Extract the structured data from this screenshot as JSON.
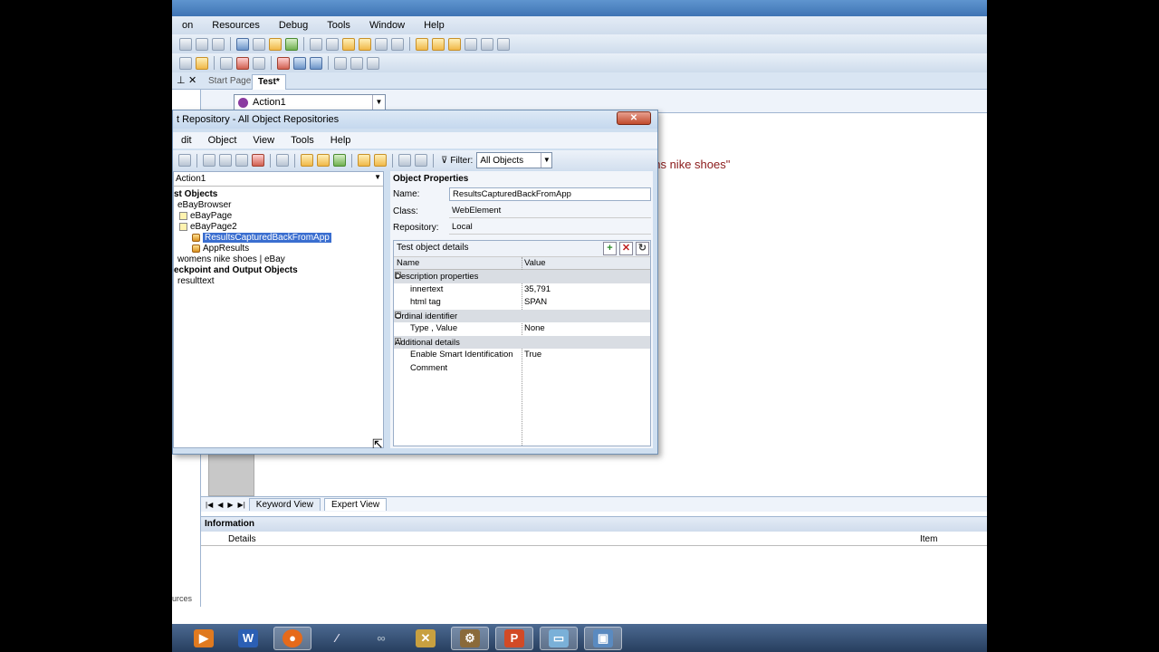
{
  "menubar": {
    "items": [
      "on",
      "Resources",
      "Debug",
      "Tools",
      "Window",
      "Help"
    ]
  },
  "tabs": {
    "start_page": "Start Page",
    "test": "Test*"
  },
  "action_select": {
    "value": "Action1"
  },
  "editor": {
    "visible_text": "ens nike shoes\""
  },
  "bottom_tabs": {
    "keyword_view": "Keyword View",
    "expert_view": "Expert View"
  },
  "info_panel": {
    "title": "Information",
    "col_details": "Details",
    "col_item": "Item"
  },
  "status_left": "urces",
  "dialog": {
    "title": "t Repository - All Object Repositories",
    "close": "✕",
    "menu": [
      "dit",
      "Object",
      "View",
      "Tools",
      "Help"
    ],
    "filter_label": "Filter:",
    "filter_value": "All Objects",
    "tree": {
      "combo_value": "Action1",
      "nodes": {
        "test_objects": "st Objects",
        "ebay_browser": "eBayBrowser",
        "ebay_page": "eBayPage",
        "ebay_page2": "eBayPage2",
        "results_captured": "ResultsCapturedBackFromApp",
        "app_results": "AppResults",
        "womens_nike": "womens nike shoes | eBay",
        "checkpoint_output": "eckpoint and Output Objects",
        "result_text": "resulttext"
      }
    },
    "properties": {
      "header": "Object Properties",
      "name_label": "Name:",
      "name_value": "ResultsCapturedBackFromApp",
      "class_label": "Class:",
      "class_value": "WebElement",
      "repo_label": "Repository:",
      "repo_value": "Local",
      "details_title": "Test object details",
      "col_name": "Name",
      "col_value": "Value",
      "group_description": "Description properties",
      "innertext_name": "innertext",
      "innertext_value": "35,791",
      "htmltag_name": "html tag",
      "htmltag_value": "SPAN",
      "group_ordinal": "Ordinal identifier",
      "type_value_name": "Type , Value",
      "type_value_value": "None",
      "group_additional": "Additional details",
      "smart_id_name": "Enable Smart Identification",
      "smart_id_value": "True",
      "comment_name": "Comment"
    }
  },
  "taskbar": {
    "apps": [
      "media-player-icon",
      "word-icon",
      "firefox-icon",
      "pen-icon",
      "glasses-icon",
      "tools-icon",
      "qtp-icon",
      "powerpoint-icon",
      "notepad-icon",
      "remote-desktop-icon"
    ]
  },
  "colors": {
    "accent_blue": "#3a6ed0",
    "editor_text": "#8b1a1a",
    "dialog_bg": "#cfdff0"
  }
}
